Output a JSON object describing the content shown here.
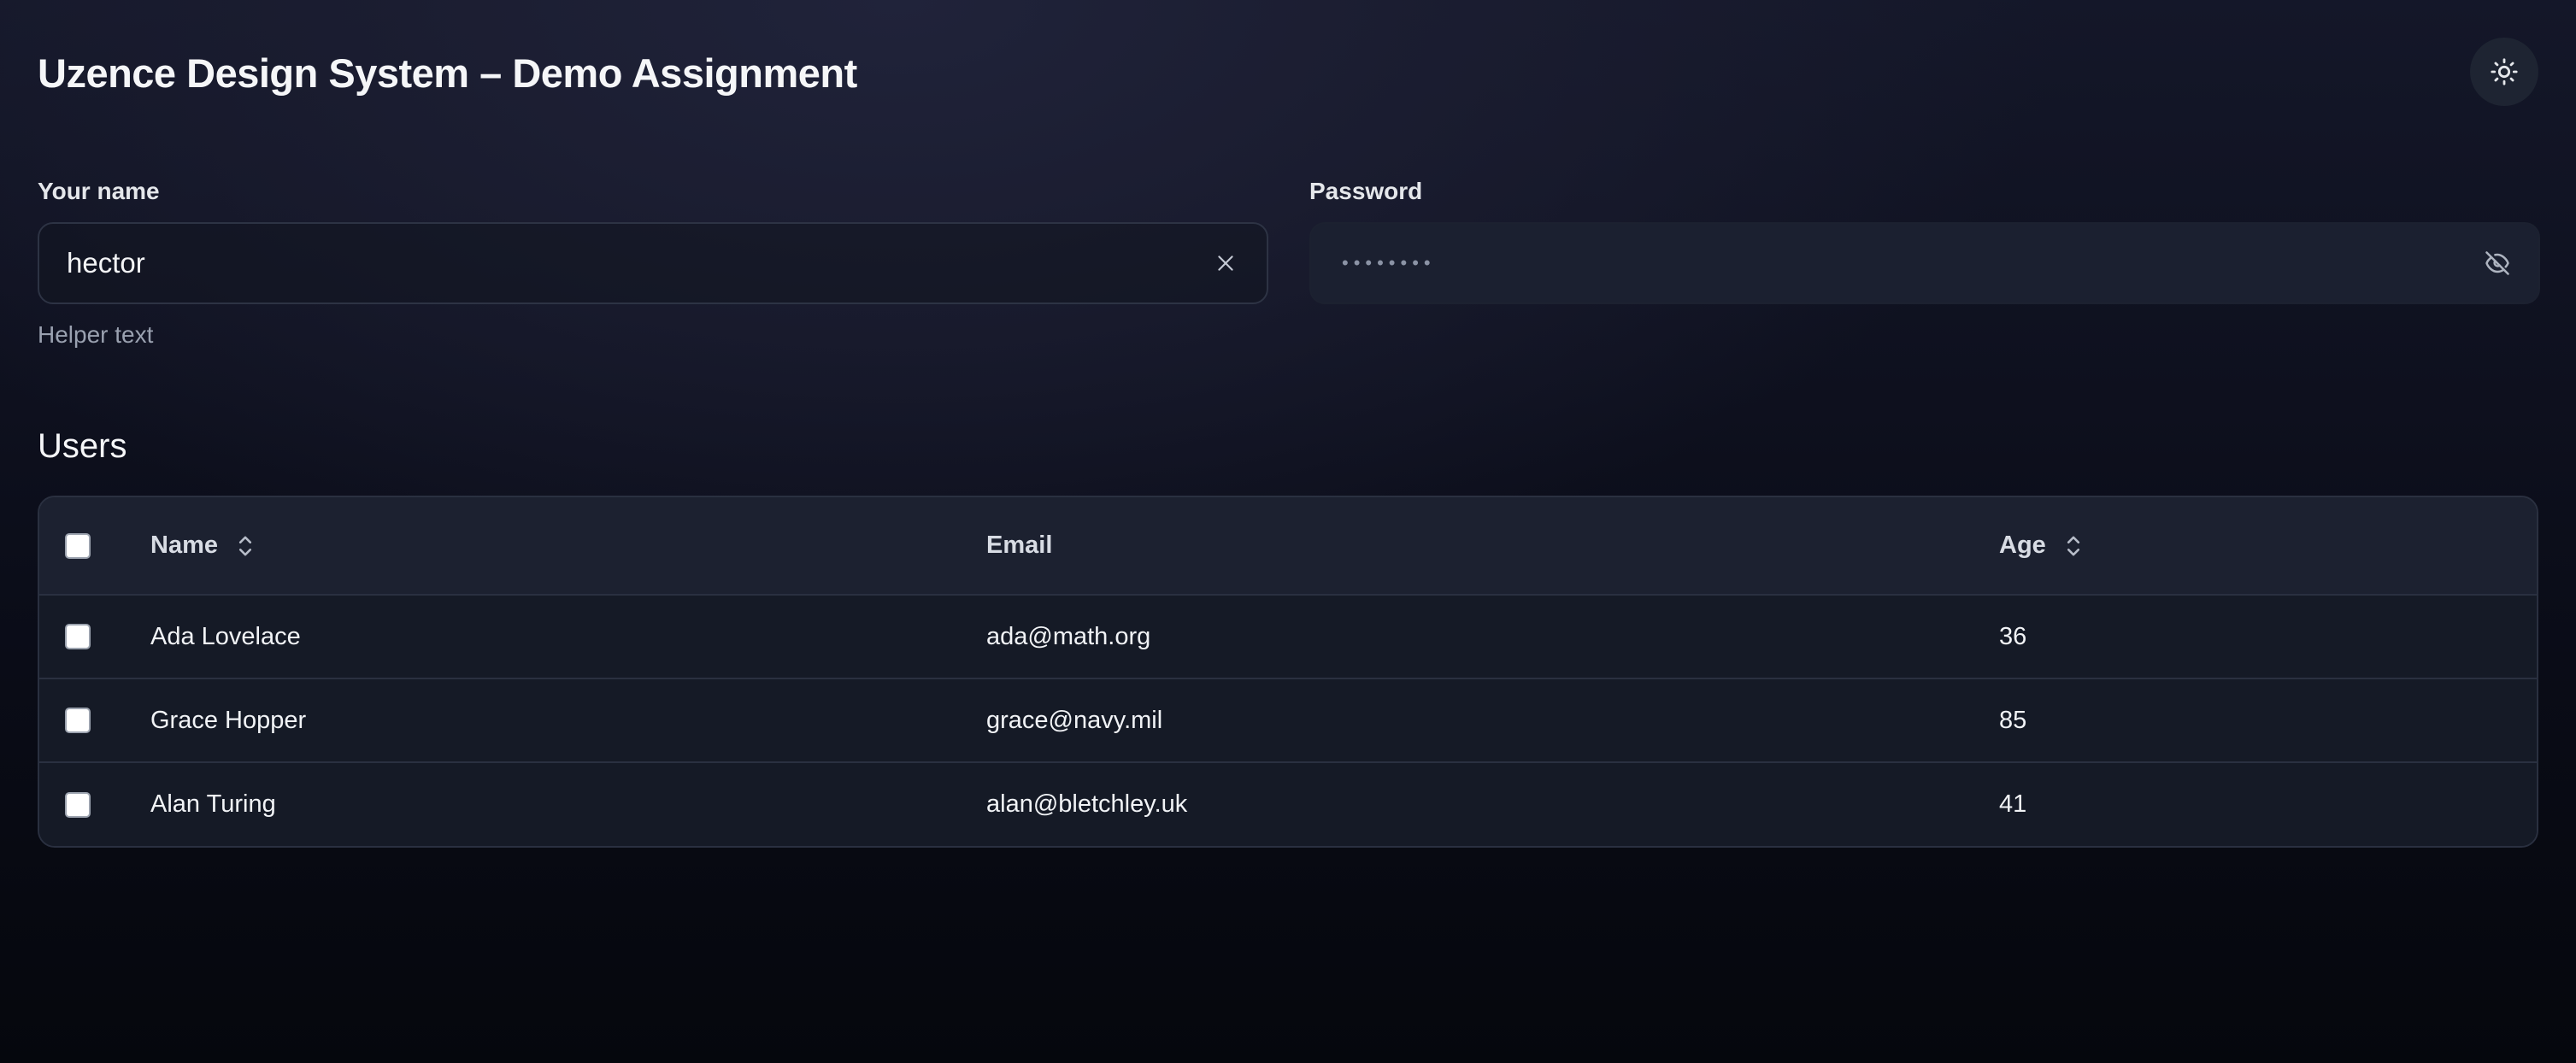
{
  "header": {
    "title": "Uzence Design System – Demo Assignment",
    "theme_toggle_icon": "sun-icon"
  },
  "form": {
    "name": {
      "label": "Your name",
      "value": "hector",
      "helper": "Helper text",
      "clear_icon": "close-icon"
    },
    "password": {
      "label": "Password",
      "masked_value": "••••••••",
      "toggle_icon": "eye-off-icon"
    }
  },
  "users": {
    "title": "Users",
    "columns": [
      {
        "label": "Name",
        "sortable": true
      },
      {
        "label": "Email",
        "sortable": false
      },
      {
        "label": "Age",
        "sortable": true
      }
    ],
    "rows": [
      {
        "name": "Ada Lovelace",
        "email": "ada@math.org",
        "age": "36"
      },
      {
        "name": "Grace Hopper",
        "email": "grace@navy.mil",
        "age": "85"
      },
      {
        "name": "Alan Turing",
        "email": "alan@bletchley.uk",
        "age": "41"
      }
    ]
  }
}
